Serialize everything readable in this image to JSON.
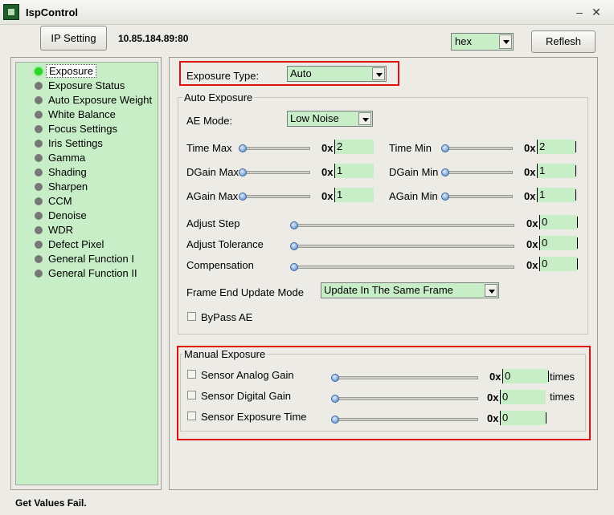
{
  "window": {
    "title": "IspControl",
    "minimize_glyph": "–",
    "close_glyph": "✕"
  },
  "toolbar": {
    "ip_setting_label": "IP Setting",
    "ip_address": "10.85.184.89:80",
    "format_value": "hex",
    "refresh_label": "Reflesh"
  },
  "sidebar": {
    "items": [
      {
        "label": "Exposure",
        "active": true
      },
      {
        "label": "Exposure Status"
      },
      {
        "label": "Auto Exposure Weight"
      },
      {
        "label": "White Balance"
      },
      {
        "label": "Focus Settings"
      },
      {
        "label": "Iris Settings"
      },
      {
        "label": "Gamma"
      },
      {
        "label": "Shading"
      },
      {
        "label": "Sharpen"
      },
      {
        "label": "CCM"
      },
      {
        "label": "Denoise"
      },
      {
        "label": "WDR"
      },
      {
        "label": "Defect Pixel"
      },
      {
        "label": "General Function I"
      },
      {
        "label": "General Function II"
      }
    ]
  },
  "exposure_type": {
    "label": "Exposure Type:",
    "value": "Auto"
  },
  "auto_exposure": {
    "title": "Auto Exposure",
    "ae_mode_label": "AE Mode:",
    "ae_mode_value": "Low Noise",
    "hex_prefix": "0x",
    "time_max": {
      "label": "Time Max",
      "value": "2"
    },
    "time_min": {
      "label": "Time Min",
      "value": "2"
    },
    "dgain_max": {
      "label": "DGain Max",
      "value": "1"
    },
    "dgain_min": {
      "label": "DGain Min",
      "value": "1"
    },
    "again_max": {
      "label": "AGain Max",
      "value": "1"
    },
    "again_min": {
      "label": "AGain Min",
      "value": "1"
    },
    "adjust_step": {
      "label": "Adjust Step",
      "value": "0"
    },
    "adjust_tolerance": {
      "label": "Adjust Tolerance",
      "value": "0"
    },
    "compensation": {
      "label": "Compensation",
      "value": "0"
    },
    "frame_end_label": "Frame End Update Mode",
    "frame_end_value": "Update In The Same Frame",
    "bypass_label": "ByPass AE"
  },
  "manual_exposure": {
    "title": "Manual Exposure",
    "hex_prefix": "0x",
    "units": "times",
    "sensor_analog_gain": {
      "label": "Sensor Analog Gain",
      "value": "0"
    },
    "sensor_digital_gain": {
      "label": "Sensor Digital Gain",
      "value": "0"
    },
    "sensor_exposure_time": {
      "label": "Sensor Exposure Time",
      "value": "0"
    }
  },
  "status": {
    "text": "Get Values Fail."
  },
  "colors": {
    "field_green": "#c8eec8",
    "highlight_red": "#e01010",
    "active_dot": "#2bd62b"
  }
}
